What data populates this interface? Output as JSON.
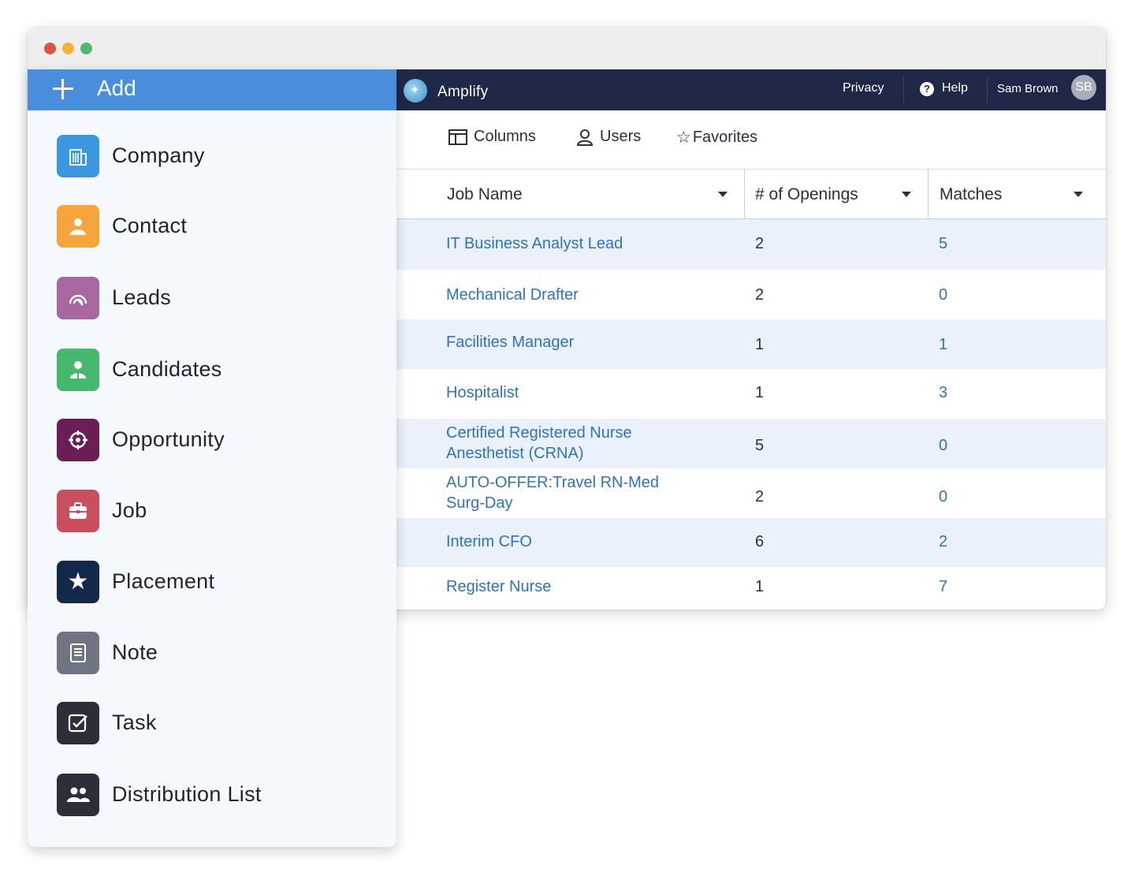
{
  "window": {
    "controls": [
      "close",
      "minimize",
      "maximize"
    ]
  },
  "topbar": {
    "app_title": "Amplify",
    "privacy": "Privacy",
    "help": "Help",
    "user_name": "Sam Brown",
    "avatar_initials": "SB"
  },
  "toolbar": {
    "columns": "Columns",
    "users": "Users",
    "favorites": "Favorites"
  },
  "table": {
    "headers": [
      "Job Name",
      "# of Openings",
      "Matches"
    ],
    "rows": [
      {
        "job": "IT Business Analyst Lead",
        "openings": "2",
        "matches": "5"
      },
      {
        "job": "Mechanical Drafter",
        "openings": "2",
        "matches": "0"
      },
      {
        "job": "Facilities Manager",
        "openings": "1",
        "matches": "1"
      },
      {
        "job": "Hospitalist",
        "openings": "1",
        "matches": "3"
      },
      {
        "job": "Certified Registered Nurse Anesthetist (CRNA)",
        "openings": "5",
        "matches": "0"
      },
      {
        "job": "AUTO-OFFER:Travel RN-Med Surg-Day",
        "openings": "2",
        "matches": "0"
      },
      {
        "job": "Interim CFO",
        "openings": "6",
        "matches": "2"
      },
      {
        "job": "Register Nurse",
        "openings": "1",
        "matches": "7"
      }
    ]
  },
  "add_menu": {
    "title": "Add",
    "items": [
      {
        "label": "Company",
        "icon": "building-icon",
        "color": "#3d97e0"
      },
      {
        "label": "Contact",
        "icon": "person-icon",
        "color": "#f5a53b"
      },
      {
        "label": "Leads",
        "icon": "signal-icon",
        "color": "#a8679e"
      },
      {
        "label": "Candidates",
        "icon": "candidate-icon",
        "color": "#45b86e"
      },
      {
        "label": "Opportunity",
        "icon": "target-icon",
        "color": "#6a1e55"
      },
      {
        "label": "Job",
        "icon": "briefcase-icon",
        "color": "#c94f5e"
      },
      {
        "label": "Placement",
        "icon": "star-icon",
        "color": "#14294a"
      },
      {
        "label": "Note",
        "icon": "note-icon",
        "color": "#6f7583"
      },
      {
        "label": "Task",
        "icon": "checkbox-icon",
        "color": "#2c2f37"
      },
      {
        "label": "Distribution List",
        "icon": "group-icon",
        "color": "#2c2f37"
      }
    ]
  },
  "colors": {
    "add_header": "#4a8ddc",
    "topbar": "#1f2847",
    "link": "#2d72c5",
    "row_alt": "#ebf1fa"
  }
}
